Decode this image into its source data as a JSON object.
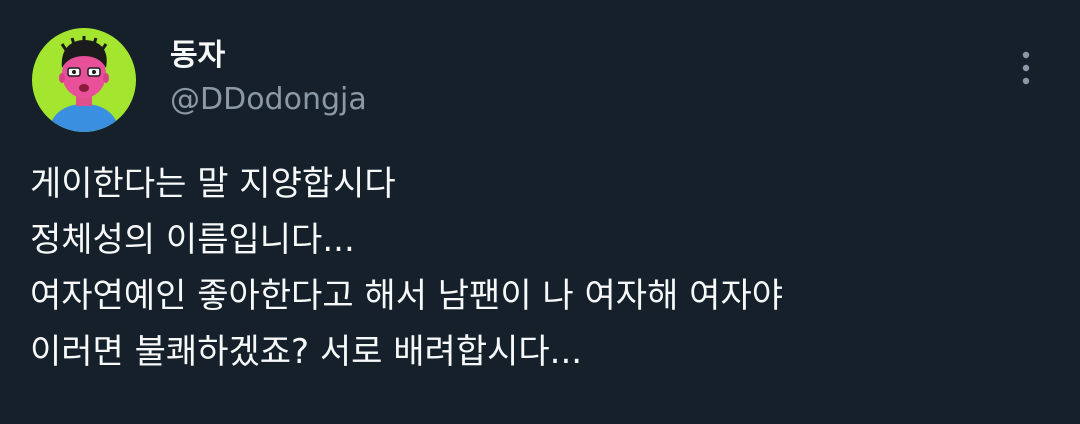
{
  "tweet": {
    "author": {
      "display_name": "동자",
      "handle": "@DDodongja",
      "avatar_icon": "cartoon-person-avatar-icon"
    },
    "more_icon": "vertical-ellipsis-icon",
    "text_lines": [
      "게이한다는 말 지양합시다",
      "정체성의 이름입니다...",
      "여자연예인 좋아한다고 해서 남팬이 나 여자해 여자야",
      "이러면 불쾌하겠죠? 서로 배려합시다..."
    ]
  },
  "colors": {
    "background": "#15202b",
    "primary_text": "#f7f9f9",
    "secondary_text": "#8b98a5",
    "avatar_background": "#a4e52f"
  }
}
